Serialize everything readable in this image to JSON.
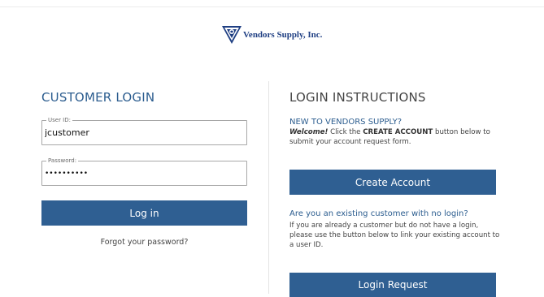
{
  "brand": {
    "name": "Vendors Supply, Inc."
  },
  "login": {
    "title": "CUSTOMER LOGIN",
    "user_label": "User ID:",
    "user_value": "jcustomer",
    "password_label": "Password:",
    "password_value": "••••••••••",
    "login_button": "Log in",
    "forgot_link": "Forgot your password?"
  },
  "instructions": {
    "title": "LOGIN INSTRUCTIONS",
    "new_heading": "NEW TO VENDORS SUPPLY?",
    "new_welcome": "Welcome!",
    "new_text_1": " Click the ",
    "new_create_bold": "CREATE ACCOUNT",
    "new_text_2": " button below to submit your account request form.",
    "create_button": "Create Account",
    "existing_heading": "Are you an existing customer with no login?",
    "existing_text": "If you are already a customer but do not have a login, please use the button below to link your existing account to a user ID.",
    "request_button": "Login Request"
  },
  "colors": {
    "primary": "#2f5f92",
    "heading_blue": "#2c5d8f",
    "logo_blue": "#1f3f83"
  }
}
